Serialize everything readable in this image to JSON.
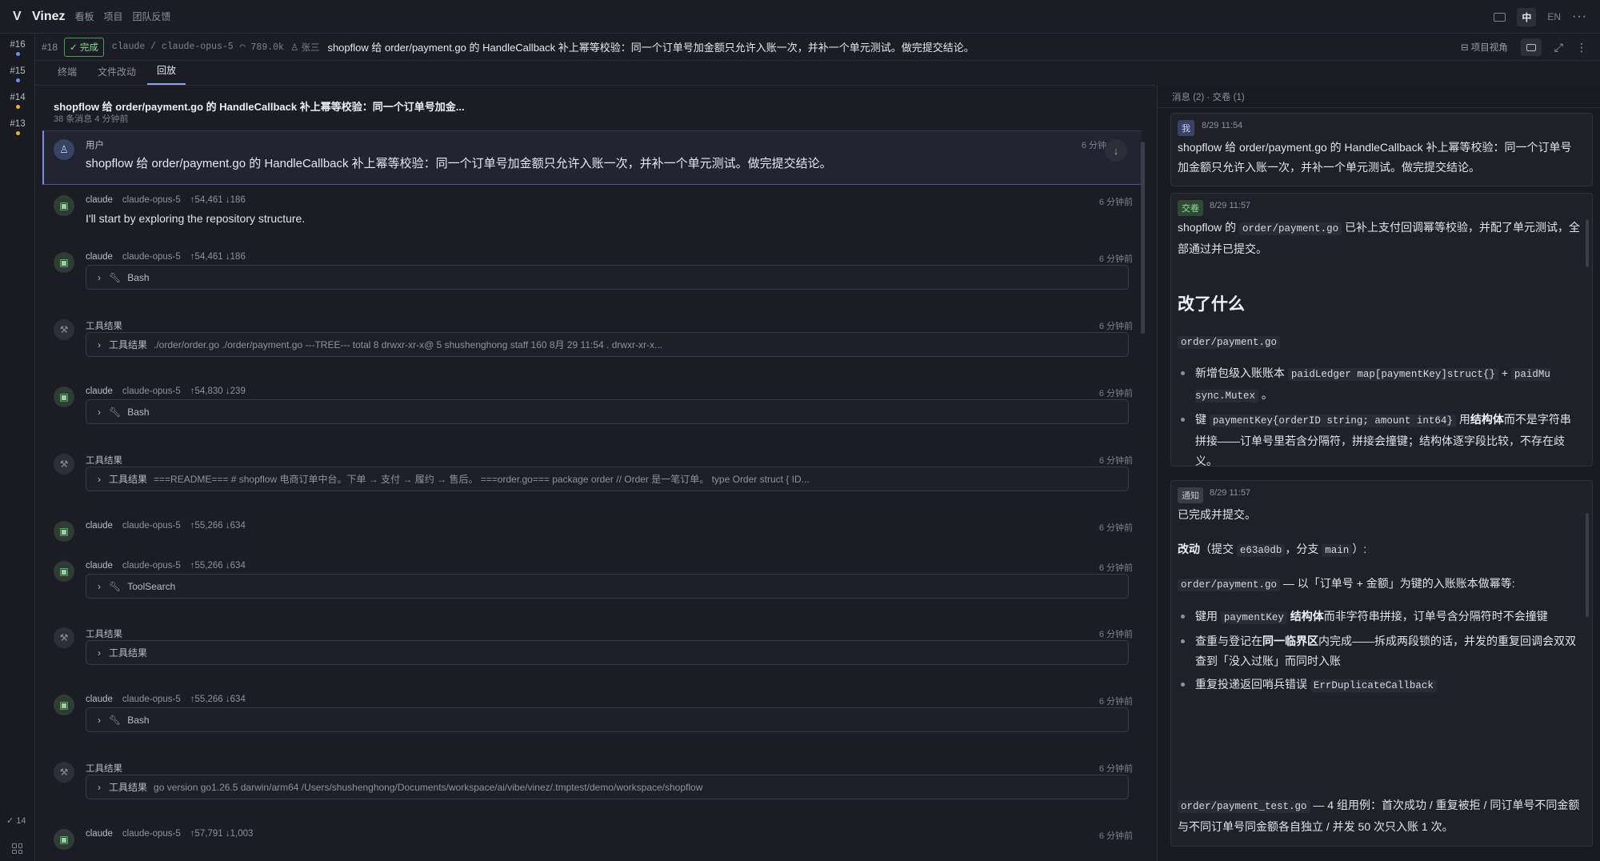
{
  "app": {
    "name": "Vinez",
    "nav": [
      "看板",
      "项目",
      "团队反馈"
    ],
    "lang_zh": "中",
    "lang_en": "EN",
    "more": "···"
  },
  "rail": {
    "items": [
      {
        "num": "#16",
        "dot_color": "#6b8ee8"
      },
      {
        "num": "#15",
        "dot_color": "#6b8ee8"
      },
      {
        "num": "#14",
        "dot_color": "#e3b341"
      },
      {
        "num": "#13",
        "dot_color": "#e3b341"
      }
    ],
    "count": "✓ 14"
  },
  "task": {
    "id": "#18",
    "status": "✓ 完成",
    "agent": "claude / claude-opus-5",
    "tokens": "◠ 789.0k",
    "person": "♙ 张三",
    "title": "shopflow 给 order/payment.go 的 HandleCallback 补上幂等校验：同一个订单号加金额只允许入账一次，并补一个单元测试。做完提交结论。",
    "project_view": "项目视角"
  },
  "tabs": [
    "终端",
    "文件改动",
    "回放"
  ],
  "conversation": {
    "title": "shopflow 给 order/payment.go 的 HandleCallback 补上幂等校验：同一个订单号加金...",
    "meta": "38 条消息  4 分钟前",
    "user_message": {
      "who": "用户",
      "text": "shopflow 给 order/payment.go 的 HandleCallback 补上幂等校验：同一个订单号加金额只允许入账一次，并补一个单元测试。做完提交结论。",
      "time": "6 分钟"
    },
    "messages": [
      {
        "kind": "bot",
        "who": "claude",
        "model": "claude-opus-5",
        "tokens": "↑54,461 ↓186",
        "time": "6 分钟前",
        "text": "I'll start by exploring the repository structure."
      },
      {
        "kind": "bot",
        "who": "claude",
        "model": "claude-opus-5",
        "tokens": "↑54,461 ↓186",
        "time": "6 分钟前",
        "tool": "Bash"
      },
      {
        "kind": "tool",
        "who": "工具结果",
        "time": "6 分钟前",
        "result_label": "工具结果",
        "preview": "./order/order.go ./order/payment.go ---TREE--- total 8 drwxr-xr-x@ 5 shushenghong staff 160 8月 29 11:54 . drwxr-xr-x..."
      },
      {
        "kind": "bot",
        "who": "claude",
        "model": "claude-opus-5",
        "tokens": "↑54,830 ↓239",
        "time": "6 分钟前",
        "tool": "Bash"
      },
      {
        "kind": "tool",
        "who": "工具结果",
        "time": "6 分钟前",
        "result_label": "工具结果",
        "preview": "===README=== # shopflow 电商订单中台。下单 → 支付 → 履约 → 售后。 ===order.go=== package order // Order 是一笔订单。 type Order struct { ID..."
      },
      {
        "kind": "bot",
        "who": "claude",
        "model": "claude-opus-5",
        "tokens": "↑55,266 ↓634",
        "time": "6 分钟前"
      },
      {
        "kind": "bot",
        "who": "claude",
        "model": "claude-opus-5",
        "tokens": "↑55,266 ↓634",
        "time": "6 分钟前",
        "tool": "ToolSearch"
      },
      {
        "kind": "tool",
        "who": "工具结果",
        "time": "6 分钟前",
        "result_label": "工具结果",
        "preview": ""
      },
      {
        "kind": "bot",
        "who": "claude",
        "model": "claude-opus-5",
        "tokens": "↑55,266 ↓634",
        "time": "6 分钟前",
        "tool": "Bash"
      },
      {
        "kind": "tool",
        "who": "工具结果",
        "time": "6 分钟前",
        "result_label": "工具结果",
        "preview": "go version go1.26.5 darwin/arm64 /Users/shushenghong/Documents/workspace/ai/vibe/vinez/.tmptest/demo/workspace/shopflow"
      },
      {
        "kind": "bot",
        "who": "claude",
        "model": "claude-opus-5",
        "tokens": "↑57,791 ↓1,003",
        "time": "6 分钟前"
      }
    ]
  },
  "right": {
    "header": "消息 (2) · 交卷 (1)",
    "card1": {
      "tag": "我",
      "time": "8/29 11:54",
      "text": "shopflow 给 order/payment.go 的 HandleCallback 补上幂等校验：同一个订单号加金额只允许入账一次，并补一个单元测试。做完提交结论。"
    },
    "card2": {
      "tag": "交卷",
      "time": "8/29 11:57",
      "p1a": "shopflow 的 ",
      "p1code": "order/payment.go",
      "p1b": " 已补上支付回调幂等校验，并配了单元测试，全部通过并已提交。",
      "heading": "改了什么",
      "file": "order/payment.go",
      "li1a": "新增包级入账账本 ",
      "li1code1": "paidLedger map[paymentKey]struct{}",
      "li1b": " + ",
      "li1code2": "paidMu sync.Mutex",
      "li1c": " 。",
      "li2a": "键 ",
      "li2code": "paymentKey{orderID string; amount int64}",
      "li2b": " 用",
      "li2bold": "结构体",
      "li2c": "而不是字符串拼接——订单号里若含分隔符，拼接会撞键；结构体逐字段比较，不存在歧义。"
    },
    "card3": {
      "tag": "通知",
      "time": "8/29 11:57",
      "p1": "已完成并提交。",
      "p2bold": "改动",
      "p2a": "（提交 ",
      "p2code1": "e63a0db",
      "p2b": "，分支 ",
      "p2code2": "main",
      "p2c": "）:",
      "p3code": "order/payment.go",
      "p3a": " — 以「订单号 + 金额」为键的入账账本做幂等:",
      "li1a": "键用 ",
      "li1code": "paymentKey",
      "li1bold": " 结构体",
      "li1b": "而非字符串拼接，订单号含分隔符时不会撞键",
      "li2a": "查重与登记在",
      "li2bold": "同一临界区",
      "li2b": "内完成——拆成两段锁的话，并发的重复回调会双双查到「没入过账」而同时入账",
      "li3a": "重复投递返回哨兵错误 ",
      "li3code": "ErrDuplicateCallback",
      "p4code": "order/payment_test.go",
      "p4a": " — 4 组用例：首次成功 / 重复被拒 / 同订单号不同金额与不同订单号同金额各自独立 / 并发 50 次只入账 1 次。"
    }
  }
}
